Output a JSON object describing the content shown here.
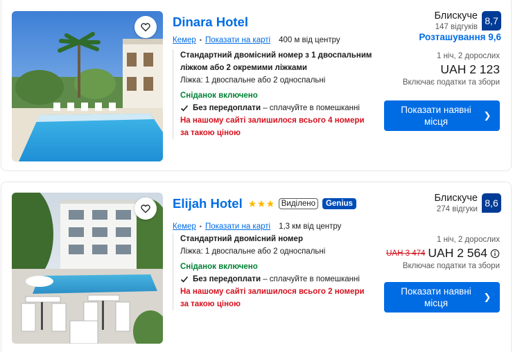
{
  "hotels": [
    {
      "name": "Dinara Hotel",
      "stars": 0,
      "badges": [],
      "location": "Кемер",
      "map_link": "Показати на карті",
      "distance": "400 м від центру",
      "room_name": "Стандартний двомісний номер з 1 двоспальним ліжком або 2 окремими ліжками",
      "beds": "Ліжка: 1 двоспальне або 2 односпальні",
      "breakfast": "Сніданок включено",
      "prepay_bold": "Без передоплати",
      "prepay_rest": " – сплачуйте в помешканні",
      "scarcity": "На нашому сайті залишилося всього 4 номери за такою ціною",
      "rating_word": "Блискуче",
      "reviews": "147 відгуків",
      "score": "8,7",
      "location_score": "Розташування 9,6",
      "nights": "1 ніч, 2 дорослих",
      "old_price": "",
      "price": "UAH 2 123",
      "taxes": "Включає податки та збори",
      "cta": "Показати наявні місця"
    },
    {
      "name": "Elijah Hotel",
      "stars": 3,
      "badges": [
        "Виділено",
        "Genius"
      ],
      "location": "Кемер",
      "map_link": "Показати на карті",
      "distance": "1,3 км від центру",
      "room_name": "Стандартний двомісний номер",
      "beds": "Ліжка: 1 двоспальне або 2 односпальні",
      "breakfast": "Сніданок включено",
      "prepay_bold": "Без передоплати",
      "prepay_rest": " – сплачуйте в помешканні",
      "scarcity": "На нашому сайті залишилося всього 2 номери за такою ціною",
      "rating_word": "Блискуче",
      "reviews": "274 відгуки",
      "score": "8,6",
      "location_score": "",
      "nights": "1 ніч, 2 дорослих",
      "old_price": "UAH 3 474",
      "price": "UAH 2 564",
      "taxes": "Включає податки та збори",
      "cta": "Показати наявні місця"
    }
  ],
  "icons": {
    "wishlist": "heart-outline-icon",
    "check": "checkmark-icon",
    "arrow": "chevron-right-icon",
    "info": "info-circle-icon",
    "star": "star-icon"
  },
  "colors": {
    "link_blue": "#006ce4",
    "score_navy": "#003b95",
    "genius_blue": "#004cb8",
    "green": "#008234",
    "red": "#d4111e",
    "star_yellow": "#febb02"
  }
}
